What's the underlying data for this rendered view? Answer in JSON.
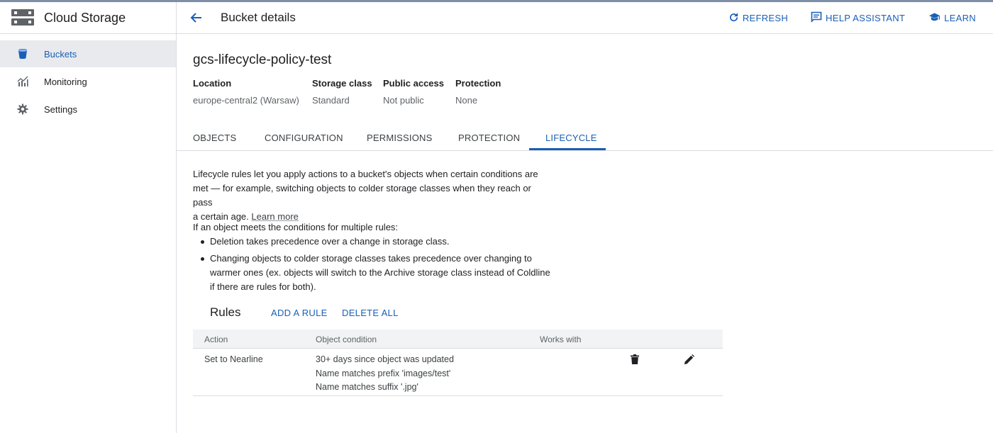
{
  "sidebar": {
    "title": "Cloud Storage",
    "logo_icon": "storage-logo-icon",
    "items": [
      {
        "label": "Buckets",
        "icon": "bucket-icon",
        "active": true
      },
      {
        "label": "Monitoring",
        "icon": "monitoring-chart-icon",
        "active": false
      },
      {
        "label": "Settings",
        "icon": "gear-icon",
        "active": false
      }
    ]
  },
  "header": {
    "title": "Bucket details",
    "back_icon": "arrow-back-icon",
    "actions": [
      {
        "label": "REFRESH",
        "icon": "refresh-icon"
      },
      {
        "label": "HELP ASSISTANT",
        "icon": "chat-help-icon"
      },
      {
        "label": "LEARN",
        "icon": "school-cap-icon"
      }
    ]
  },
  "bucket": {
    "name": "gcs-lifecycle-policy-test",
    "meta": [
      {
        "label": "Location",
        "value": "europe-central2 (Warsaw)"
      },
      {
        "label": "Storage class",
        "value": "Standard"
      },
      {
        "label": "Public access",
        "value": "Not public"
      },
      {
        "label": "Protection",
        "value": "None"
      }
    ]
  },
  "tabs": [
    {
      "label": "OBJECTS",
      "active": false
    },
    {
      "label": "CONFIGURATION",
      "active": false
    },
    {
      "label": "PERMISSIONS",
      "active": false
    },
    {
      "label": "PROTECTION",
      "active": false
    },
    {
      "label": "LIFECYCLE",
      "active": true
    }
  ],
  "lifecycle": {
    "intro_lines": [
      "Lifecycle rules let you apply actions to a bucket's objects when certain conditions are",
      "met — for example, switching objects to colder storage classes when they reach or pass",
      "a certain age."
    ],
    "learn_more": "Learn more",
    "precedence_heading": "If an object meets the conditions for multiple rules:",
    "bullets": [
      {
        "lines": [
          "Deletion takes precedence over a change in storage class."
        ]
      },
      {
        "lines": [
          "Changing objects to colder storage classes takes precedence over changing to",
          "warmer ones (ex. objects will switch to the Archive storage class instead of Coldline",
          "if there are rules for both)."
        ]
      }
    ]
  },
  "rules": {
    "title": "Rules",
    "add_label": "ADD A RULE",
    "delete_all_label": "DELETE ALL",
    "columns": [
      "Action",
      "Object condition",
      "Works with"
    ],
    "rows": [
      {
        "action": "Set to Nearline",
        "conditions": [
          "30+ days since object was updated",
          "Name matches prefix 'images/test'",
          "Name matches suffix '.jpg'"
        ],
        "works_with": "",
        "delete_icon": "trash-icon",
        "edit_icon": "pencil-icon"
      }
    ]
  },
  "colors": {
    "accent": "#1a5fb4",
    "active_nav_bg": "#e8eaed",
    "table_header_bg": "#f1f3f4",
    "divider": "#dadce0"
  }
}
